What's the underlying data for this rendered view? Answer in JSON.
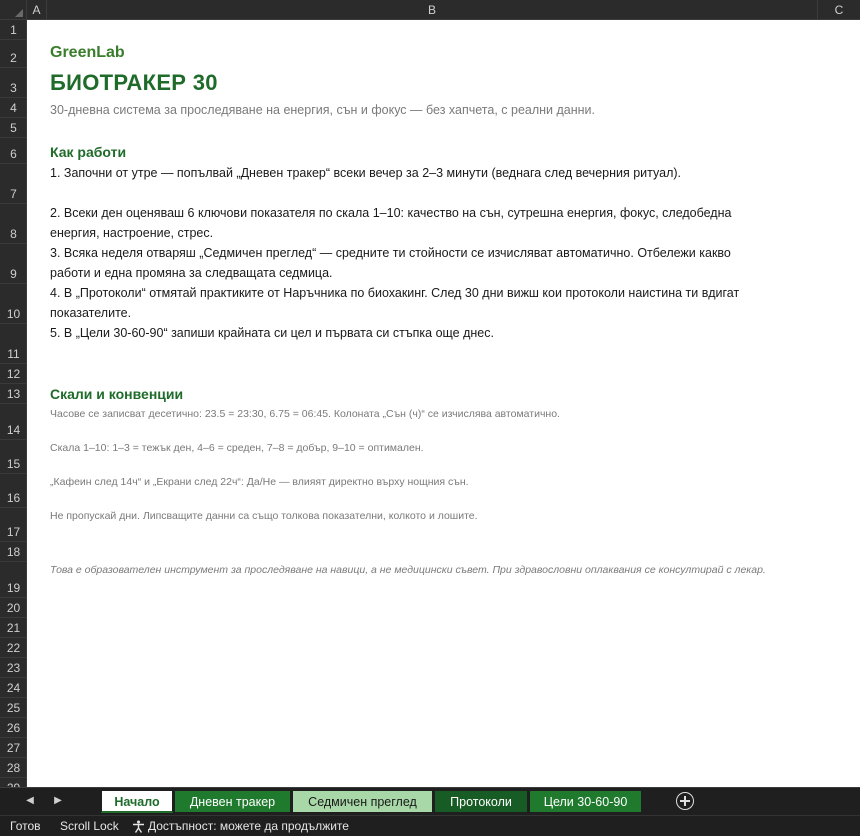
{
  "columns": [
    "A",
    "B",
    "C"
  ],
  "rows": [
    "1",
    "2",
    "3",
    "4",
    "5",
    "6",
    "7",
    "8",
    "9",
    "10",
    "11",
    "12",
    "13",
    "14",
    "15",
    "16",
    "17",
    "18",
    "19",
    "20",
    "21",
    "22",
    "23",
    "24",
    "25",
    "26",
    "27",
    "28",
    "29"
  ],
  "sheet": {
    "brand": "GreenLab",
    "title": "БИОТРАКЕР 30",
    "subtitle": "30-дневна система за проследяване на енергия, сън и фокус — без хапчета, с реални данни.",
    "how_title": "Как работи",
    "steps": [
      "1. Започни от утре — попълвай „Дневен тракер“ всеки вечер за 2–3 минути (веднага след вечерния ритуал).",
      "2. Всеки ден оценяваш 6 ключови показателя по скала 1–10: качество на сън, сутрешна енергия, фокус, следобедна",
      "енергия, настроение, стрес.",
      "3. Всяка неделя отваряш „Седмичен преглед“ — средните ти стойности се изчисляват автоматично. Отбележи какво",
      "работи и една промяна за следващата седмица.",
      "4. В „Протоколи“ отмятай практиките от Наръчника по биохакинг. След 30 дни вижш кои протоколи наистина ти вдигат",
      "показателите.",
      "5. В „Цели 30-60-90“ запиши крайната си цел и първата си стъпка още днес."
    ],
    "scales_title": "Скали и конвенции",
    "notes": [
      "Часове се записват десетично: 23.5 = 23:30, 6.75 = 06:45. Колоната „Сън (ч)“ се изчислява автоматично.",
      "Скала 1–10: 1–3 = тежък ден, 4–6 = среден, 7–8 = добър, 9–10 = оптимален.",
      "„Кафеин след 14ч“ и „Екрани след 22ч“: Да/Не — влияят директно върху нощния сън.",
      "Не пропускай дни. Липсващите данни са също толкова показателни, колкото и лошите."
    ],
    "disclaimer": "Това е образователен инструмент за проследяване на навици, а не медицински съвет. При здравословни оплаквания се консултирай с лекар."
  },
  "tabs": [
    {
      "label": "Начало"
    },
    {
      "label": "Дневен тракер"
    },
    {
      "label": "Седмичен преглед"
    },
    {
      "label": "Протоколи"
    },
    {
      "label": "Цели 30-60-90"
    }
  ],
  "status": {
    "ready": "Готов",
    "scroll_lock": "Scroll Lock",
    "accessibility": "Достъпност: можете да продължите"
  },
  "colors": {
    "brand_green": "#3a7d2c",
    "title_green": "#1e6b2a",
    "tab_green": "#1f7a2e",
    "tab_light": "#a8d8a8",
    "tab_dark": "#175c24"
  }
}
